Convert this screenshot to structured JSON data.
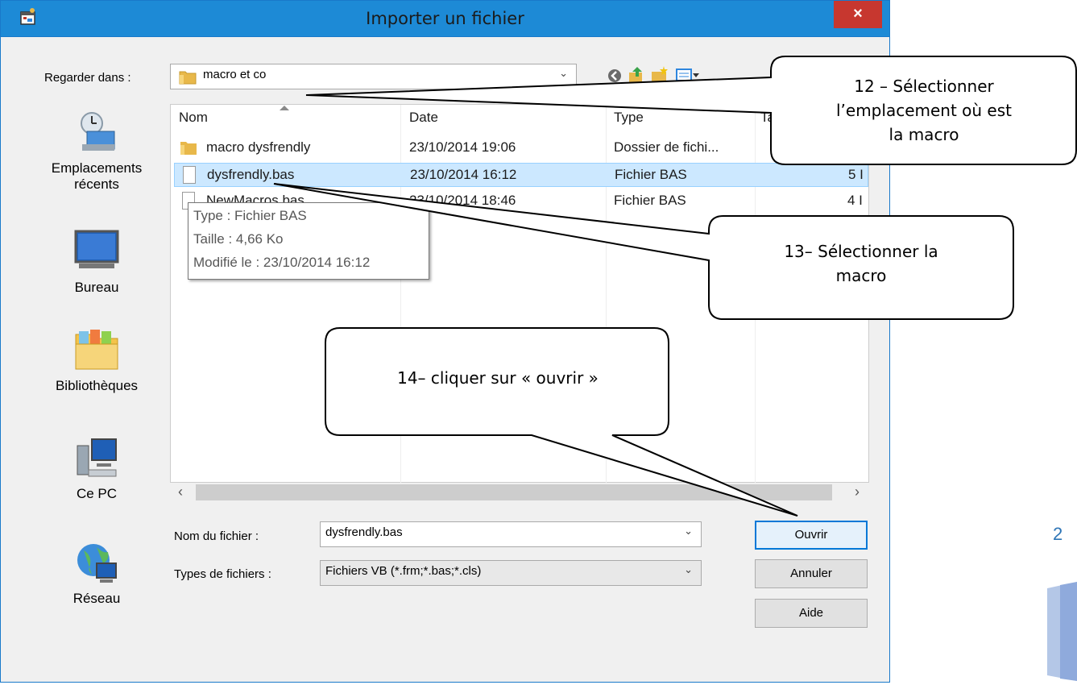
{
  "dialog": {
    "title": "Importer un fichier",
    "close_glyph": "×"
  },
  "lookin": {
    "label": "Regarder dans :",
    "value": "macro et co"
  },
  "places": [
    {
      "label": "Emplacements récents",
      "icon": "recent-places-icon"
    },
    {
      "label": "Bureau",
      "icon": "desktop-icon"
    },
    {
      "label": "Bibliothèques",
      "icon": "libraries-icon"
    },
    {
      "label": "Ce PC",
      "icon": "computer-icon"
    },
    {
      "label": "Réseau",
      "icon": "network-icon"
    }
  ],
  "columns": [
    "Nom",
    "Date",
    "Type",
    "Ta"
  ],
  "files": [
    {
      "name": "macro dysfrendly",
      "date": "23/10/2014 19:06",
      "type": "Dossier de fichi...",
      "size": "",
      "kind": "folder"
    },
    {
      "name": "dysfrendly.bas",
      "date": "23/10/2014 16:12",
      "type": "Fichier BAS",
      "size": "5 I",
      "kind": "file",
      "selected": true
    },
    {
      "name": "NewMacros.bas",
      "date": "23/10/2014 18:46",
      "type": "Fichier BAS",
      "size": "4 I",
      "kind": "file"
    }
  ],
  "tooltip": {
    "type": "Type : Fichier BAS",
    "size": "Taille : 4,66 Ko",
    "modified": "Modifié le : 23/10/2014 16:12"
  },
  "filename": {
    "label": "Nom du fichier :",
    "value": "dysfrendly.bas"
  },
  "filetype": {
    "label": "Types de fichiers :",
    "value": "Fichiers VB (*.frm;*.bas;*.cls)"
  },
  "buttons": {
    "open": "Ouvrir",
    "cancel": "Annuler",
    "help": "Aide"
  },
  "callouts": {
    "c12_line1": "12 – Sélectionner",
    "c12_line2": "l’emplacement où est",
    "c12_line3": "la macro",
    "c13_line1": "13– Sélectionner  la",
    "c13_line2": "macro",
    "c14_line1": "14– cliquer sur « ouvrir »"
  },
  "page_number": "2",
  "colors": {
    "titlebar": "#1d8ad6",
    "close": "#c7372f",
    "selection": "#cce8ff",
    "page_number": "#2e75b6"
  }
}
